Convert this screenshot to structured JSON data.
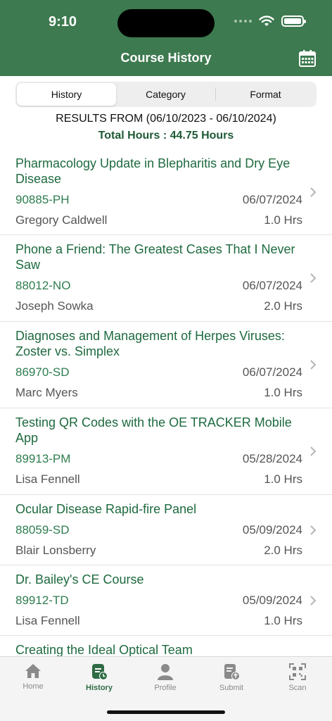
{
  "status": {
    "time": "9:10"
  },
  "header": {
    "title": "Course History",
    "calendar_icon": "calendar-icon"
  },
  "segments": [
    "History",
    "Category",
    "Format"
  ],
  "results_range": "RESULTS FROM (06/10/2023 - 06/10/2024)",
  "total_hours": "Total Hours : 44.75 Hours",
  "courses": [
    {
      "title": "Pharmacology Update in Blepharitis and Dry Eye Disease",
      "code": "90885-PH",
      "date": "06/07/2024",
      "instructor": "Gregory Caldwell",
      "hours": "1.0 Hrs"
    },
    {
      "title": "Phone a Friend: The Greatest Cases That I Never Saw",
      "code": "88012-NO",
      "date": "06/07/2024",
      "instructor": "Joseph Sowka",
      "hours": "2.0 Hrs"
    },
    {
      "title": "Diagnoses and Management of Herpes Viruses: Zoster vs. Simplex",
      "code": "86970-SD",
      "date": "06/07/2024",
      "instructor": "Marc Myers",
      "hours": "1.0 Hrs"
    },
    {
      "title": "Testing QR Codes with the OE TRACKER Mobile App",
      "code": "89913-PM",
      "date": "05/28/2024",
      "instructor": "Lisa Fennell",
      "hours": "1.0 Hrs"
    },
    {
      "title": "Ocular Disease Rapid-fire Panel",
      "code": "88059-SD",
      "date": "05/09/2024",
      "instructor": "Blair Lonsberry",
      "hours": "2.0 Hrs"
    },
    {
      "title": "Dr. Bailey's CE Course",
      "code": "89912-TD",
      "date": "05/09/2024",
      "instructor": "Lisa Fennell",
      "hours": "1.0 Hrs"
    },
    {
      "title": "Creating the Ideal Optical Team",
      "code": "",
      "date": "",
      "instructor": "",
      "hours": ""
    }
  ],
  "tabs": [
    {
      "label": "Home",
      "icon": "home-icon"
    },
    {
      "label": "History",
      "icon": "history-icon"
    },
    {
      "label": "Profile",
      "icon": "profile-icon"
    },
    {
      "label": "Submit",
      "icon": "submit-icon"
    },
    {
      "label": "Scan",
      "icon": "scan-icon"
    }
  ],
  "colors": {
    "brand": "#3d7a4f",
    "link": "#1e6a3f"
  }
}
